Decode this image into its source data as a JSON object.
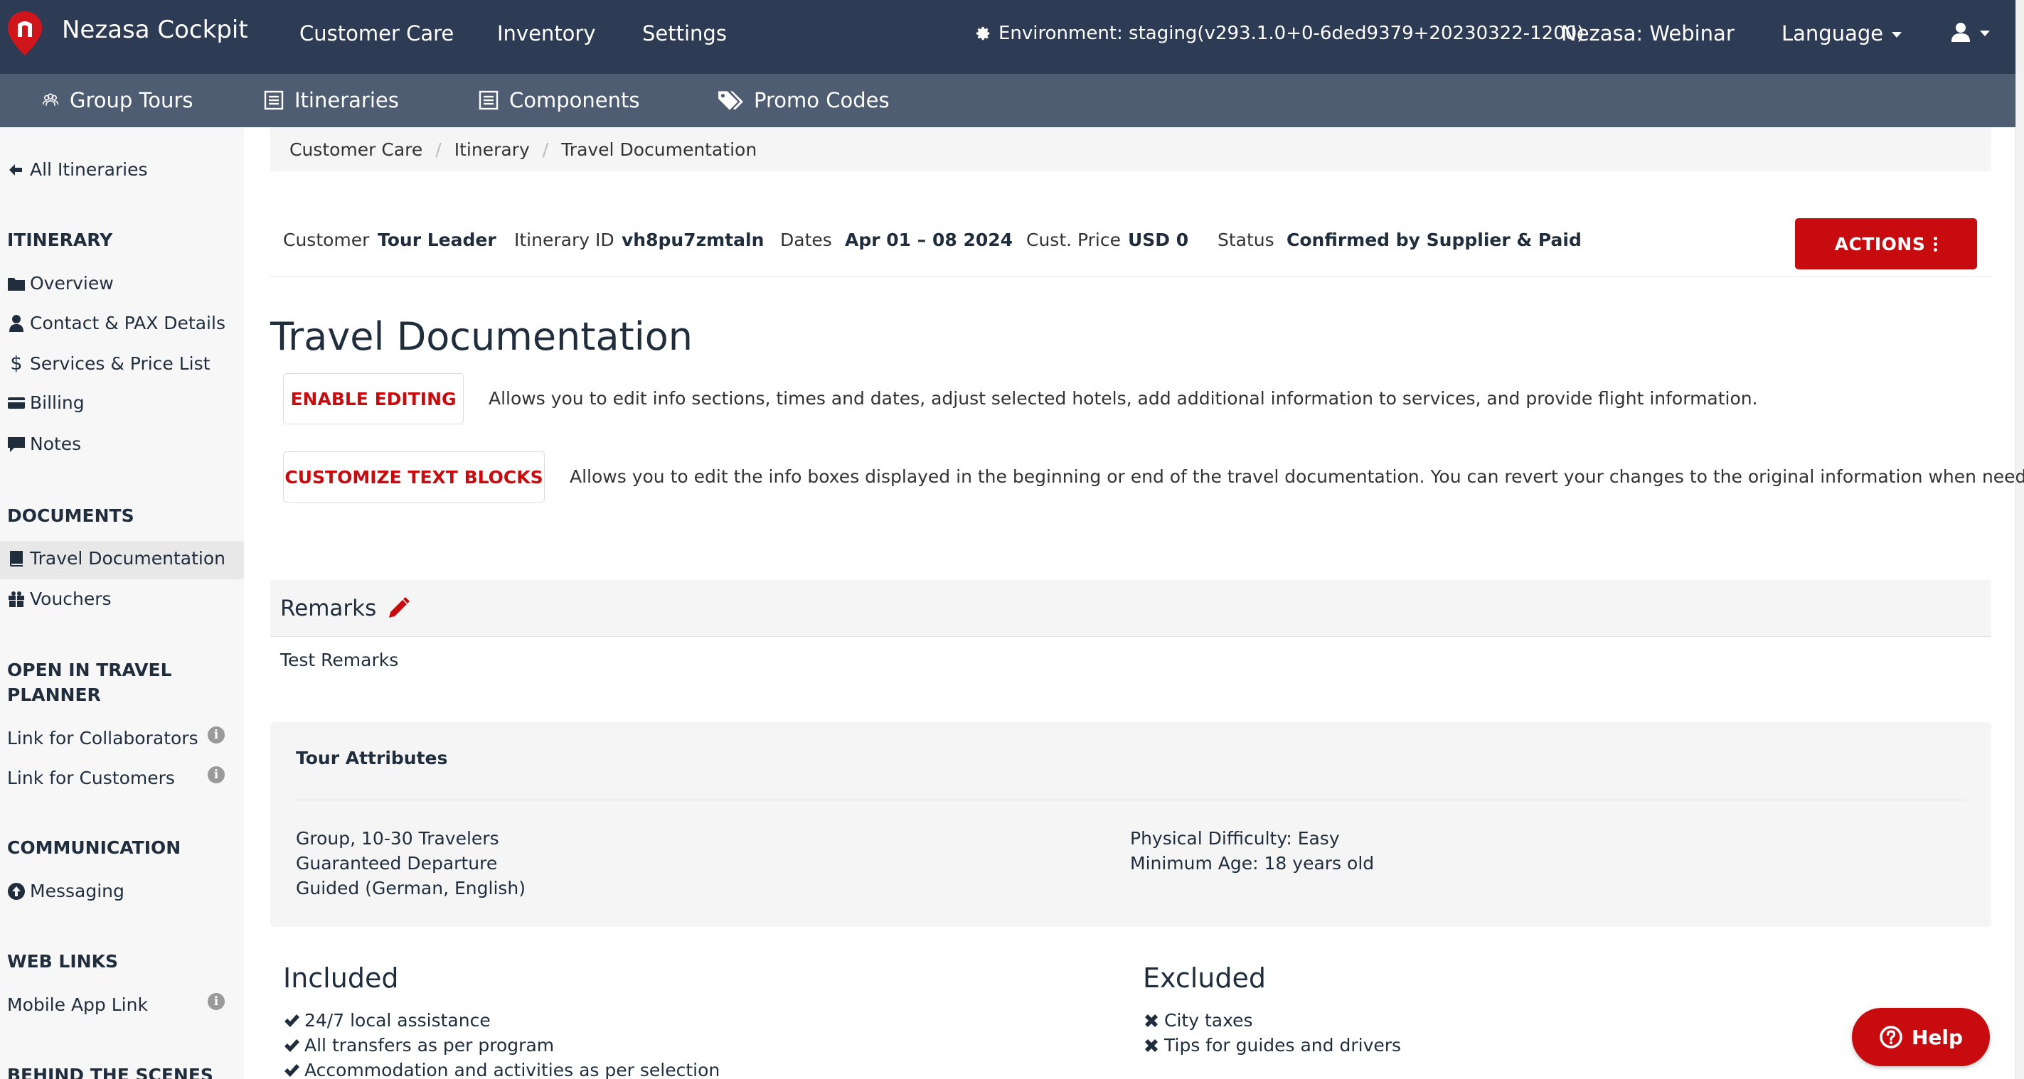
{
  "topbar": {
    "brand": "Nezasa Cockpit",
    "nav": [
      "Customer Care",
      "Inventory",
      "Settings"
    ],
    "environment": "Environment: staging(v293.1.0+0-6ded9379+20230322-1200)",
    "account": "Nezasa: Webinar",
    "language": "Language"
  },
  "subbar": {
    "items": [
      "Group Tours",
      "Itineraries",
      "Components",
      "Promo Codes"
    ]
  },
  "sidebar": {
    "back": "All Itineraries",
    "itinerary_head": "ITINERARY",
    "itinerary_items": [
      "Overview",
      "Contact & PAX Details",
      "Services & Price List",
      "Billing",
      "Notes"
    ],
    "documents_head": "DOCUMENTS",
    "documents_items": [
      "Travel Documentation",
      "Vouchers"
    ],
    "planner_head": "OPEN IN TRAVEL PLANNER",
    "planner_items": [
      "Link for Collaborators",
      "Link for Customers"
    ],
    "communication_head": "COMMUNICATION",
    "communication_items": [
      "Messaging"
    ],
    "weblinks_head": "WEB LINKS",
    "weblinks_items": [
      "Mobile App Link"
    ],
    "behind_head": "BEHIND THE SCENES"
  },
  "breadcrumb": [
    "Customer Care",
    "Itinerary",
    "Travel Documentation"
  ],
  "summary": {
    "customer_label": "Customer",
    "customer": "Tour Leader",
    "id_label": "Itinerary ID",
    "id": "vh8pu7zmtaln",
    "dates_label": "Dates",
    "dates": "Apr 01 – 08 2024",
    "price_label": "Cust. Price",
    "price": "USD 0",
    "status_label": "Status",
    "status": "Confirmed by Supplier & Paid",
    "actions": "ACTIONS"
  },
  "page": {
    "title": "Travel Documentation",
    "enable_editing": "ENABLE EDITING",
    "enable_editing_desc": "Allows you to edit info sections, times and dates, adjust selected hotels, add additional information to services, and provide flight information.",
    "customize": "CUSTOMIZE TEXT BLOCKS",
    "customize_desc": "Allows you to edit the info boxes displayed in the beginning or end of the travel documentation. You can revert your changes to the original information when needed,"
  },
  "remarks": {
    "title": "Remarks",
    "text": "Test Remarks"
  },
  "tour_attributes": {
    "title": "Tour Attributes",
    "left": [
      "Group, 10-30 Travelers",
      "Guaranteed Departure",
      "Guided (German, English)"
    ],
    "right": [
      "Physical Difficulty: Easy",
      "Minimum Age: 18 years old"
    ]
  },
  "included": {
    "title": "Included",
    "items": [
      "24/7 local assistance",
      "All transfers as per program",
      "Accommodation and activities as per selection"
    ]
  },
  "excluded": {
    "title": "Excluded",
    "items": [
      "City taxes",
      "Tips for guides and drivers"
    ]
  },
  "help": "Help",
  "colors": {
    "topbar": "#2d3b55",
    "subbar": "#4f5d73",
    "accent": "#c80b0f"
  }
}
